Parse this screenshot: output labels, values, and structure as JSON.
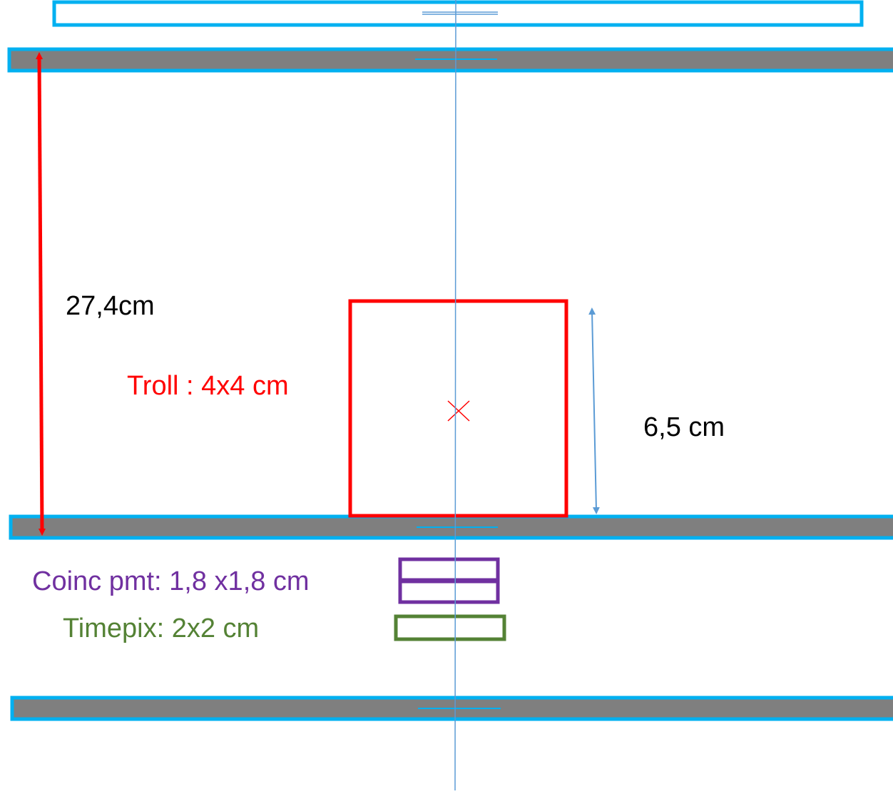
{
  "labels": {
    "total_distance": "27,4cm",
    "troll": "Troll : 4x4 cm",
    "troll_offset": "6,5 cm",
    "coinc_pmt": "Coinc pmt: 1,8 x1,8 cm",
    "timepix": "Timepix: 2x2 cm"
  },
  "colors": {
    "plate_border": "#00b0f0",
    "plate_fill": "#7f7f7f",
    "axis": "#5b9bd5",
    "dimension_main": "#ff0000",
    "dimension_offset": "#5b9bd5",
    "troll": "#ff0000",
    "coinc_pmt": "#7030a0",
    "timepix": "#548235",
    "text_default": "#000000"
  }
}
